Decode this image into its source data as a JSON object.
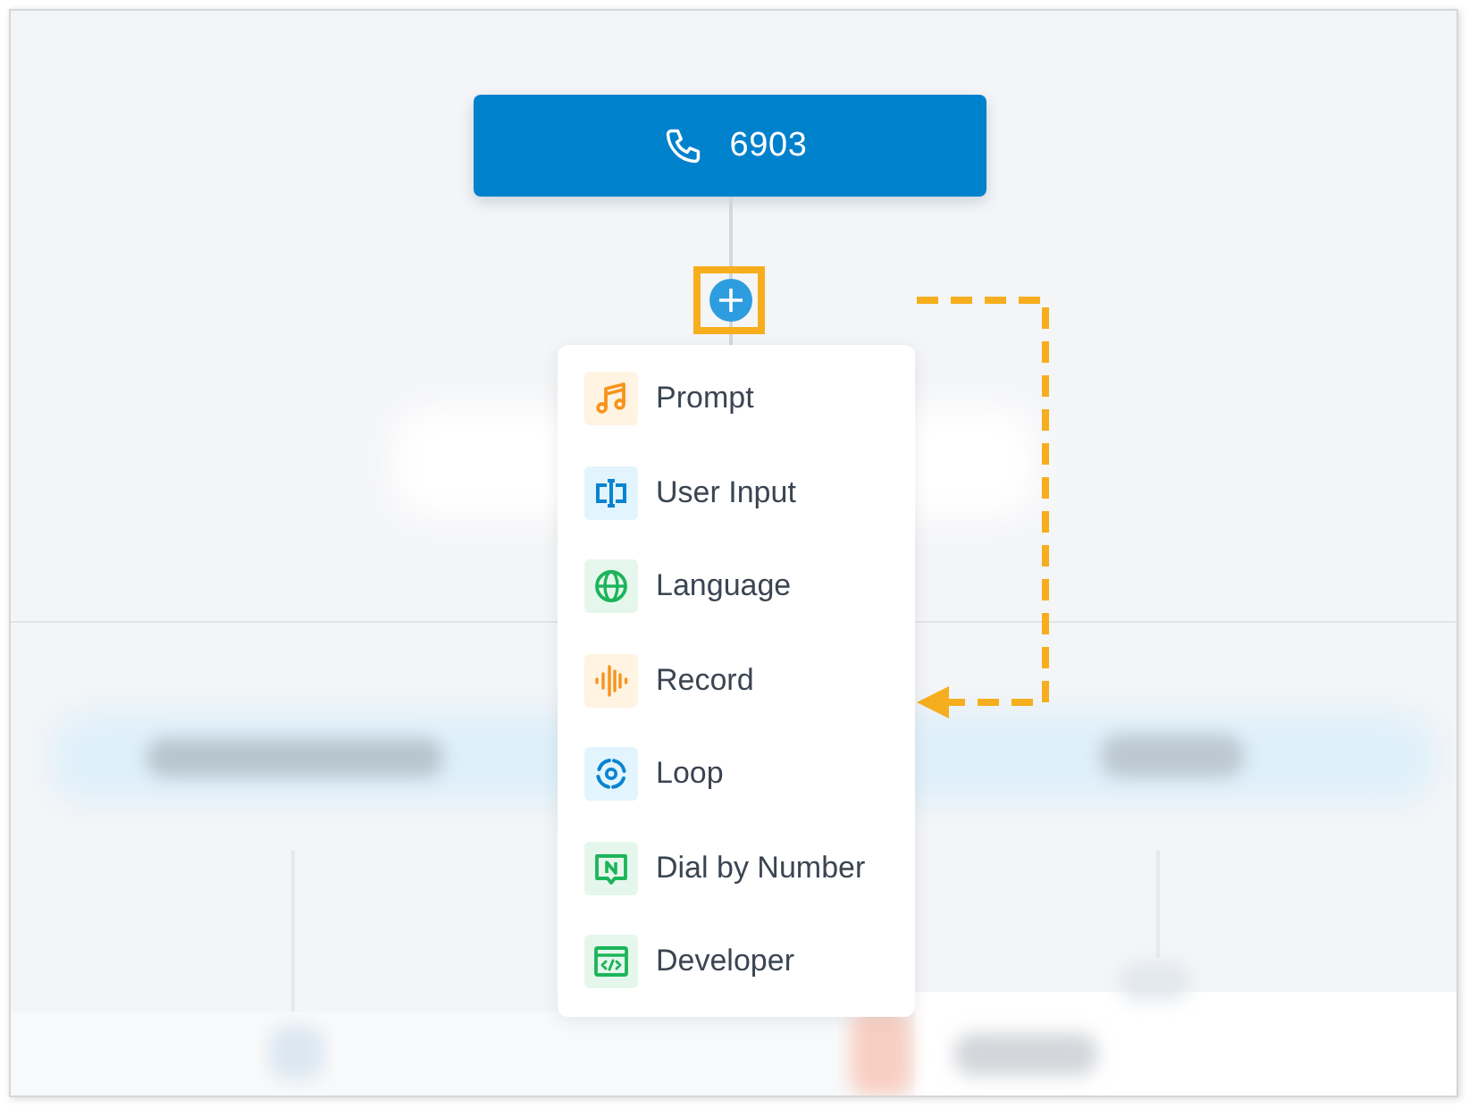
{
  "trigger_node": {
    "label": "6903"
  },
  "add_button": {
    "highlighted": true
  },
  "menu": {
    "items": [
      {
        "kind": "prompt",
        "label": "Prompt"
      },
      {
        "kind": "input",
        "label": "User Input"
      },
      {
        "kind": "language",
        "label": "Language"
      },
      {
        "kind": "record",
        "label": "Record"
      },
      {
        "kind": "loop",
        "label": "Loop"
      },
      {
        "kind": "dial",
        "label": "Dial by Number"
      },
      {
        "kind": "developer",
        "label": "Developer"
      }
    ]
  }
}
